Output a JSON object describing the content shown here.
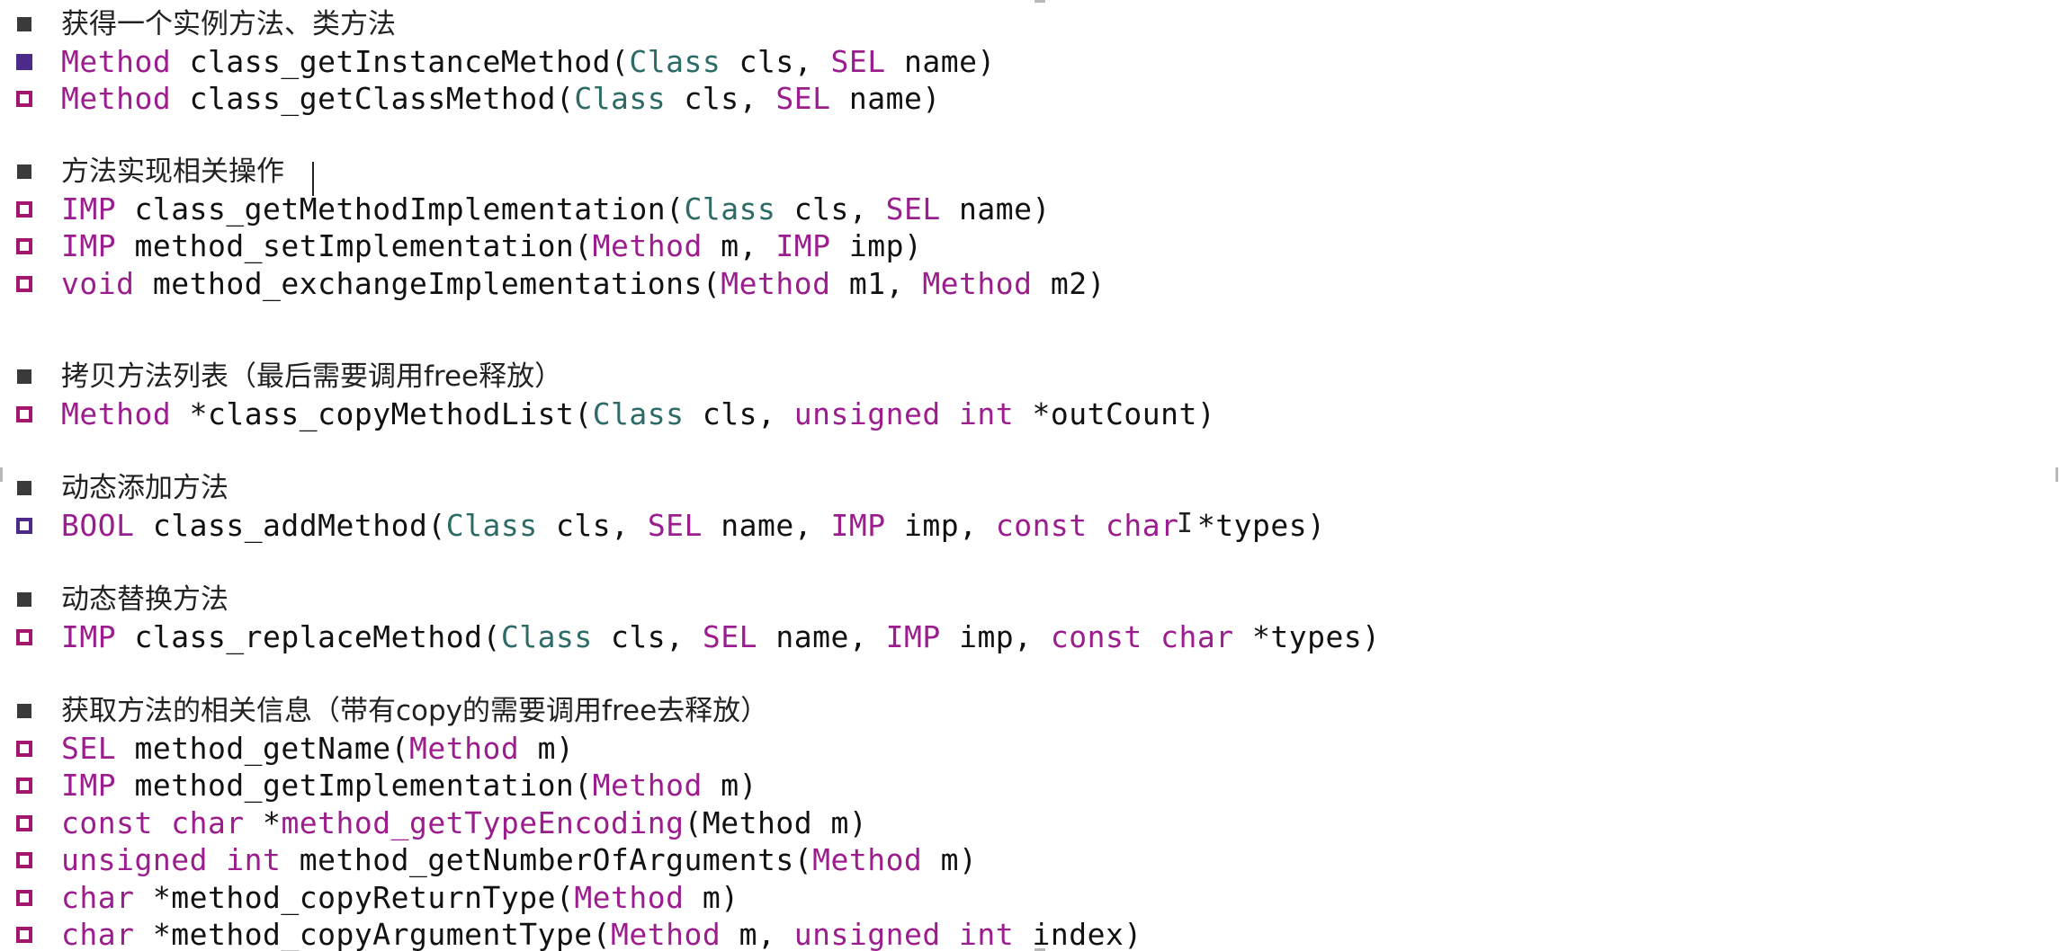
{
  "sections": [
    {
      "heading": "获得一个实例方法、类方法",
      "lines": [
        [
          {
            "t": "Method",
            "c": "kw"
          },
          {
            "t": " class_getInstanceMethod(",
            "c": "blk"
          },
          {
            "t": "Class",
            "c": "typ"
          },
          {
            "t": " cls, ",
            "c": "blk"
          },
          {
            "t": "SEL",
            "c": "kw"
          },
          {
            "t": " name)",
            "c": "blk"
          }
        ],
        [
          {
            "t": "Method",
            "c": "kw"
          },
          {
            "t": " class_getClassMethod(",
            "c": "blk"
          },
          {
            "t": "Class",
            "c": "typ"
          },
          {
            "t": " cls, ",
            "c": "blk"
          },
          {
            "t": "SEL",
            "c": "kw"
          },
          {
            "t": " name)",
            "c": "blk"
          }
        ]
      ]
    },
    {
      "heading": "方法实现相关操作",
      "lines": [
        [
          {
            "t": "IMP",
            "c": "kw"
          },
          {
            "t": " class_getMethodImplementation(",
            "c": "blk"
          },
          {
            "t": "Class",
            "c": "typ"
          },
          {
            "t": " cls, ",
            "c": "blk"
          },
          {
            "t": "SEL",
            "c": "kw"
          },
          {
            "t": " name)",
            "c": "blk"
          }
        ],
        [
          {
            "t": "IMP",
            "c": "kw"
          },
          {
            "t": " method_setImplementation(",
            "c": "blk"
          },
          {
            "t": "Method",
            "c": "kw"
          },
          {
            "t": " m, ",
            "c": "blk"
          },
          {
            "t": "IMP",
            "c": "kw"
          },
          {
            "t": " imp)",
            "c": "blk"
          }
        ],
        [
          {
            "t": "void",
            "c": "kw"
          },
          {
            "t": " method_exchangeImplementations(",
            "c": "blk"
          },
          {
            "t": "Method",
            "c": "kw"
          },
          {
            "t": " m1, ",
            "c": "blk"
          },
          {
            "t": "Method",
            "c": "kw"
          },
          {
            "t": " m2)",
            "c": "blk"
          }
        ]
      ]
    },
    {
      "heading": "拷贝方法列表（最后需要调用free释放）",
      "lines": [
        [
          {
            "t": "Method",
            "c": "kw"
          },
          {
            "t": " *class_copyMethodList(",
            "c": "blk"
          },
          {
            "t": "Class",
            "c": "typ"
          },
          {
            "t": " cls, ",
            "c": "blk"
          },
          {
            "t": "unsigned int",
            "c": "kw"
          },
          {
            "t": " *outCount)",
            "c": "blk"
          }
        ]
      ]
    },
    {
      "heading": "动态添加方法",
      "lines": [
        [
          {
            "t": "BOOL",
            "c": "kw"
          },
          {
            "t": " class_addMethod(",
            "c": "blk"
          },
          {
            "t": "Class",
            "c": "typ"
          },
          {
            "t": " cls, ",
            "c": "blk"
          },
          {
            "t": "SEL",
            "c": "kw"
          },
          {
            "t": " name, ",
            "c": "blk"
          },
          {
            "t": "IMP",
            "c": "kw"
          },
          {
            "t": " imp, ",
            "c": "blk"
          },
          {
            "t": "const char",
            "c": "kw"
          },
          {
            "t": " *types)",
            "c": "blk"
          }
        ]
      ]
    },
    {
      "heading": "动态替换方法",
      "lines": [
        [
          {
            "t": "IMP",
            "c": "kw"
          },
          {
            "t": " class_replaceMethod(",
            "c": "blk"
          },
          {
            "t": "Class",
            "c": "typ"
          },
          {
            "t": " cls, ",
            "c": "blk"
          },
          {
            "t": "SEL",
            "c": "kw"
          },
          {
            "t": " name, ",
            "c": "blk"
          },
          {
            "t": "IMP",
            "c": "kw"
          },
          {
            "t": " imp, ",
            "c": "blk"
          },
          {
            "t": "const char",
            "c": "kw"
          },
          {
            "t": " *types)",
            "c": "blk"
          }
        ]
      ]
    },
    {
      "heading": "获取方法的相关信息（带有copy的需要调用free去释放）",
      "lines": [
        [
          {
            "t": "SEL",
            "c": "kw"
          },
          {
            "t": " method_getName(",
            "c": "blk"
          },
          {
            "t": "Method",
            "c": "kw"
          },
          {
            "t": " m)",
            "c": "blk"
          }
        ],
        [
          {
            "t": "IMP",
            "c": "kw"
          },
          {
            "t": " method_getImplementation(",
            "c": "blk"
          },
          {
            "t": "Method",
            "c": "kw"
          },
          {
            "t": " m)",
            "c": "blk"
          }
        ],
        [
          {
            "t": "const char",
            "c": "kw"
          },
          {
            "t": " *",
            "c": "blk"
          },
          {
            "t": "method_getTypeEncoding",
            "c": "kw"
          },
          {
            "t": "(Method m)",
            "c": "blk"
          }
        ],
        [
          {
            "t": "unsigned int",
            "c": "kw"
          },
          {
            "t": " method_getNumberOfArguments(",
            "c": "blk"
          },
          {
            "t": "Method",
            "c": "kw"
          },
          {
            "t": " m)",
            "c": "blk"
          }
        ],
        [
          {
            "t": "char",
            "c": "kw"
          },
          {
            "t": " *method_copyReturnType(",
            "c": "blk"
          },
          {
            "t": "Method",
            "c": "kw"
          },
          {
            "t": " m)",
            "c": "blk"
          }
        ],
        [
          {
            "t": "char",
            "c": "kw"
          },
          {
            "t": " *method_copyArgumentType(",
            "c": "blk"
          },
          {
            "t": "Method",
            "c": "kw"
          },
          {
            "t": " m, ",
            "c": "blk"
          },
          {
            "t": "unsigned int",
            "c": "kw"
          },
          {
            "t": " index)",
            "c": "blk"
          }
        ]
      ]
    }
  ],
  "colors": {
    "keyword": "#9b1d8e",
    "type_class": "#2d6b66",
    "plain": "#111111",
    "bullet_heading": "#3a3a3a",
    "bullet_selected": "#4b2a8a",
    "bullet_magenta": "#a3166e"
  },
  "icons": {
    "heading_bullet": "filled-square-icon",
    "line_bullet": "hollow-square-icon",
    "cursor": "text-cursor-icon"
  }
}
